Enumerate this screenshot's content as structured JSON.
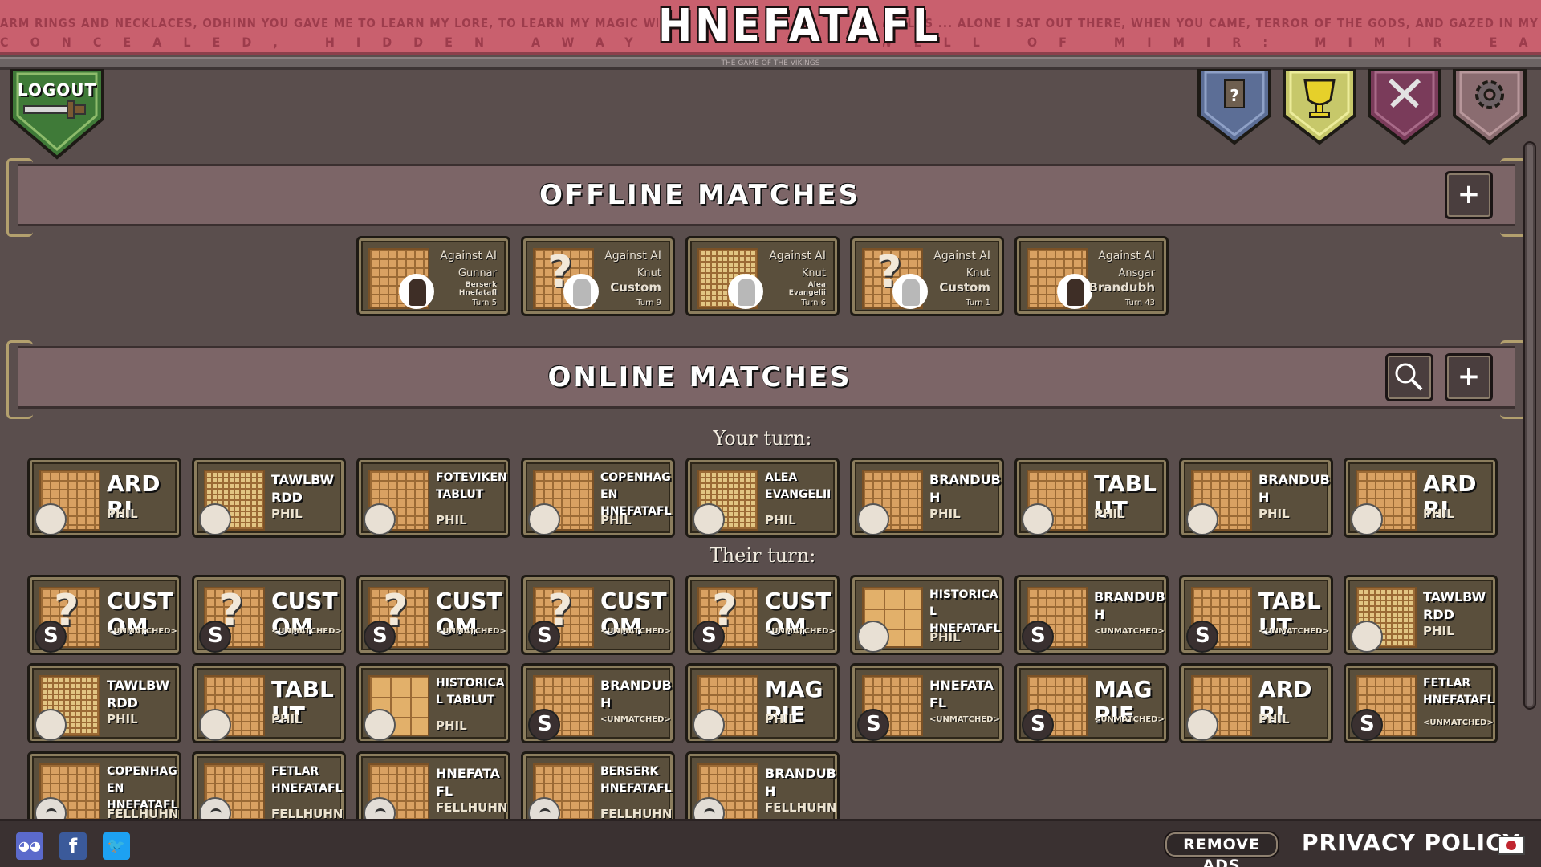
{
  "header": {
    "title": "HNEFATAFL",
    "rune_line_1": "arm rings and necklaces, odhinn you gave me to learn my lore, to learn my magic wider and wider through all worlds ... Alone I sat out there, when you came, terror of the gods, and gazed in my eyes. What do you ask of me? Why tempt me? Odhinn, I know where your eye",
    "rune_line_2": "concealed, hidden away in the well of Mimir: Mimir each ... drinks from Valfather's pledge. Well would you know more?",
    "sub_text": "THE GAME OF THE VIKINGS"
  },
  "logout": {
    "label": "LOGOUT"
  },
  "top_icons": [
    {
      "name": "help",
      "icon": "question-scroll-icon",
      "color": "#5c6e96"
    },
    {
      "name": "achievements",
      "icon": "trophy-icon",
      "color": "#c7c86a"
    },
    {
      "name": "close",
      "icon": "crossed-swords-icon",
      "color": "#7a3b5a"
    },
    {
      "name": "settings",
      "icon": "gear-icon",
      "color": "#8a6c70"
    }
  ],
  "offline": {
    "title": "OFFLINE MATCHES",
    "add_label": "+",
    "matches": [
      {
        "top": "Against AI",
        "opponent": "Gunnar",
        "game": "Berserk Hnefatafl",
        "turn": "Turn 5",
        "unknown": false,
        "portrait": "dark"
      },
      {
        "top": "Against AI",
        "opponent": "Knut",
        "game": "Custom",
        "turn": "Turn 9",
        "unknown": true,
        "portrait": "pale"
      },
      {
        "top": "Against AI",
        "opponent": "Knut",
        "game": "Alea Evangelii",
        "turn": "Turn 6",
        "unknown": false,
        "portrait": "pale"
      },
      {
        "top": "Against AI",
        "opponent": "Knut",
        "game": "Custom",
        "turn": "Turn 1",
        "unknown": true,
        "portrait": "pale"
      },
      {
        "top": "Against AI",
        "opponent": "Ansgar",
        "game": "Brandubh",
        "turn": "Turn 43",
        "unknown": false,
        "portrait": "dark"
      }
    ]
  },
  "online": {
    "title": "ONLINE MATCHES",
    "search_label": "search",
    "add_label": "+",
    "your_turn_label": "Your turn:",
    "their_turn_label": "Their turn:",
    "your_turn": [
      {
        "name": "ARD RI",
        "sub": "PHIL"
      },
      {
        "name": "TAWLBWRDD",
        "sub": "PHIL"
      },
      {
        "name": "FOTEVIKEN TABLUT",
        "sub": "PHIL"
      },
      {
        "name": "COPENHAGEN HNEFATAFL",
        "sub": "PHIL"
      },
      {
        "name": "ALEA EVANGELII",
        "sub": "PHIL"
      },
      {
        "name": "BRANDUBH",
        "sub": "PHIL"
      },
      {
        "name": "TABLUT",
        "sub": "PHIL"
      },
      {
        "name": "BRANDUBH",
        "sub": "PHIL"
      },
      {
        "name": "ARD RI",
        "sub": "PHIL"
      }
    ],
    "their_turn": [
      {
        "name": "CUSTOM",
        "sub": "<UNMATCHED>"
      },
      {
        "name": "CUSTOM",
        "sub": "<UNMATCHED>"
      },
      {
        "name": "CUSTOM",
        "sub": "<UNMATCHED>"
      },
      {
        "name": "CUSTOM",
        "sub": "<UNMATCHED>"
      },
      {
        "name": "CUSTOM",
        "sub": "<UNMATCHED>"
      },
      {
        "name": "HISTORICAL HNEFATAFL",
        "sub": "PHIL"
      },
      {
        "name": "BRANDUBH",
        "sub": "<UNMATCHED>"
      },
      {
        "name": "TABLUT",
        "sub": "<UNMATCHED>"
      },
      {
        "name": "TAWLBWRDD",
        "sub": "PHIL"
      },
      {
        "name": "TAWLBWRDD",
        "sub": "PHIL"
      },
      {
        "name": "TABLUT",
        "sub": "PHIL"
      },
      {
        "name": "HISTORICAL TABLUT",
        "sub": "PHIL"
      },
      {
        "name": "BRANDUBH",
        "sub": "<UNMATCHED>"
      },
      {
        "name": "MAGPIE",
        "sub": "PHIL"
      },
      {
        "name": "HNEFATAFL",
        "sub": "<UNMATCHED>"
      },
      {
        "name": "MAGPIE",
        "sub": "<UNMATCHED>"
      },
      {
        "name": "ARD RI",
        "sub": "PHIL"
      },
      {
        "name": "FETLAR HNEFATAFL",
        "sub": "<UNMATCHED>"
      },
      {
        "name": "COPENHAGEN HNEFATAFL",
        "sub": "FELLHUHN"
      },
      {
        "name": "FETLAR HNEFATAFL",
        "sub": "FELLHUHN"
      },
      {
        "name": "HNEFATAFL",
        "sub": "FELLHUHN"
      },
      {
        "name": "BERSERK HNEFATAFL",
        "sub": "FELLHUHN"
      },
      {
        "name": "BRANDUBH",
        "sub": "FELLHUHN"
      }
    ]
  },
  "footer": {
    "discord": "discord-icon",
    "facebook": "f",
    "twitter": "twitter-bird-icon",
    "remove_ads": "REMOVE ADS",
    "privacy": "PRIVACY POLICY",
    "flag": "japan-flag-icon"
  }
}
